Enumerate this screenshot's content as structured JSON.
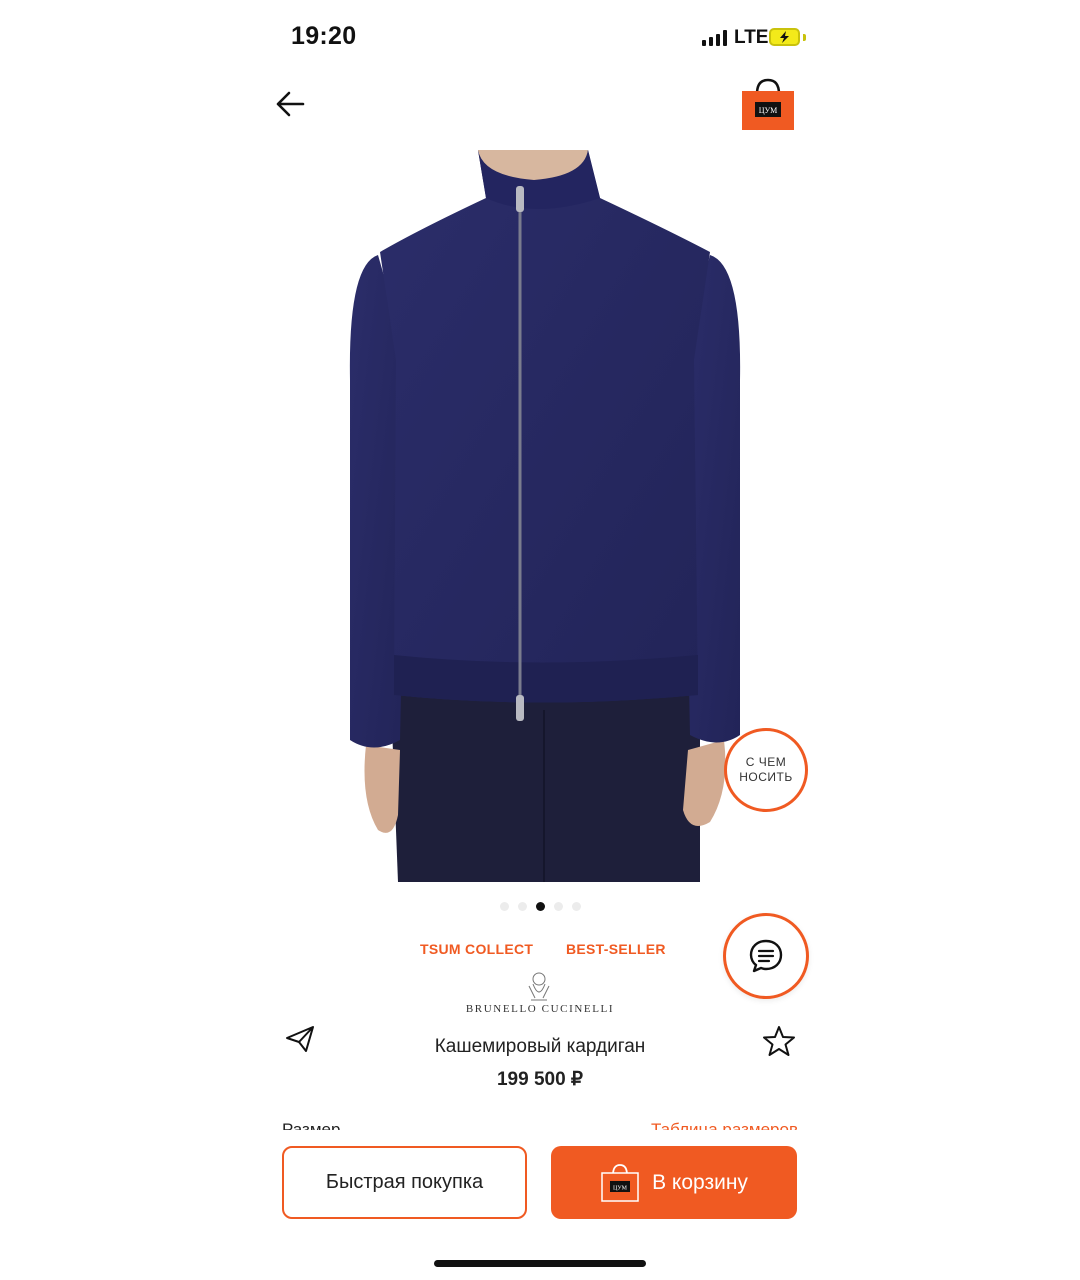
{
  "status_bar": {
    "time": "19:20",
    "network": "LTE"
  },
  "brand_colors": {
    "accent": "#f05a22",
    "sweater": "#26285f",
    "trousers": "#1e1f3a"
  },
  "header": {
    "back_icon": "arrow-left-icon",
    "bag_icon": "shopping-bag-icon",
    "bag_text": "ЦУМ"
  },
  "gallery": {
    "image": "navy-zip-cardigan-photo",
    "slide_count": 5,
    "active_slide": 3
  },
  "wear_with": {
    "line1": "С ЧЕМ",
    "line2": "НОСИТЬ"
  },
  "tags": [
    "TSUM COLLECT",
    "BEST-SELLER"
  ],
  "brand": {
    "name": "BRUNELLO CUCINELLI"
  },
  "product": {
    "title": "Кашемировый кардиган",
    "price": "199 500 ₽"
  },
  "size_row": {
    "label": "Размер",
    "table_link": "Таблица размеров"
  },
  "actions": {
    "quick_buy": "Быстрая покупка",
    "add_to_cart": "В корзину",
    "cart_icon_text": "ЦУМ"
  },
  "icons": {
    "share": "paper-plane-icon",
    "favorite": "star-icon",
    "chat": "chat-bubble-icon"
  }
}
